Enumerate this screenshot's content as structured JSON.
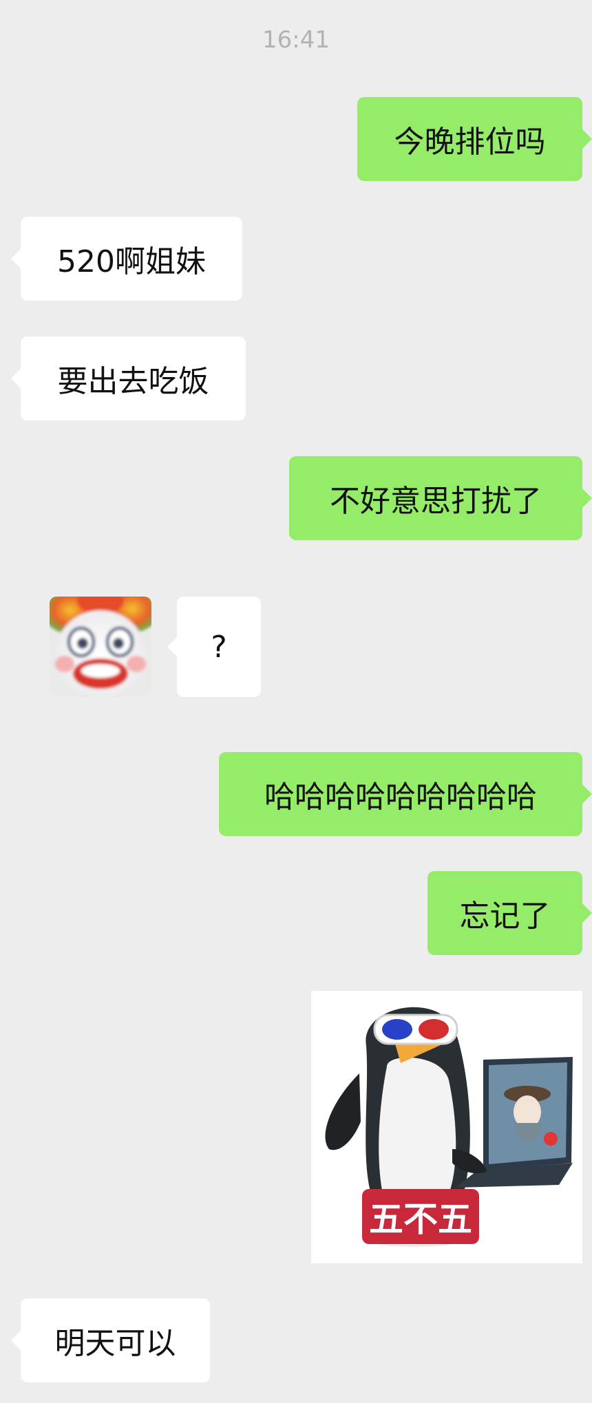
{
  "chat": {
    "timestamp": "16:41",
    "messages": [
      {
        "side": "out",
        "text": "今晚排位吗"
      },
      {
        "side": "in",
        "text": "520啊姐妹"
      },
      {
        "side": "in",
        "text": "要出去吃饭"
      },
      {
        "side": "out",
        "text": "不好意思打扰了"
      },
      {
        "side": "in",
        "type": "sticker",
        "icon": "clown-face-sticker"
      },
      {
        "side": "in",
        "text": "?"
      },
      {
        "side": "out",
        "text": "哈哈哈哈哈哈哈哈哈"
      },
      {
        "side": "out",
        "text": "忘记了"
      },
      {
        "side": "out",
        "type": "sticker",
        "icon": "penguin-laptop-sticker",
        "caption": "五不五"
      },
      {
        "side": "in",
        "text": "明天可以"
      }
    ]
  },
  "colors": {
    "background": "#ededed",
    "incoming_bubble": "#ffffff",
    "outgoing_bubble": "#95ec69",
    "timestamp": "#b2b2b2",
    "sticker_caption": "#c8283a"
  }
}
